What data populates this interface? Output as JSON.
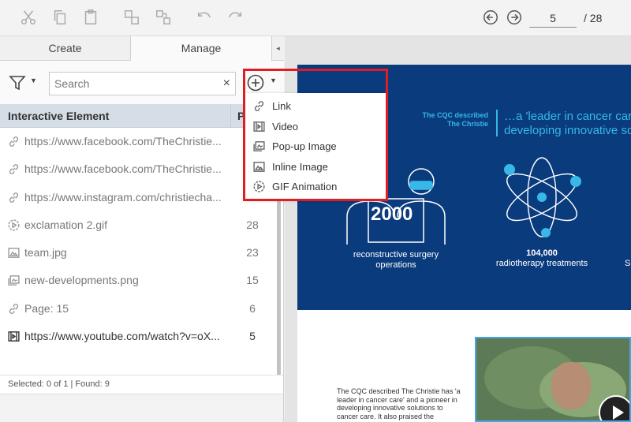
{
  "toolbar": {
    "current_page": "5",
    "total_pages": "/ 28"
  },
  "panel": {
    "tabs": [
      {
        "label": "Create"
      },
      {
        "label": "Manage"
      }
    ],
    "collapse_glyph": "◂",
    "search": {
      "placeholder": "Search",
      "value": "",
      "clear_glyph": "×"
    },
    "columns": {
      "name": "Interactive Element",
      "page": "Pa"
    },
    "rows": [
      {
        "icon": "link-icon",
        "text": "https://www.facebook.com/TheChristie...",
        "page": ""
      },
      {
        "icon": "link-icon",
        "text": "https://www.facebook.com/TheChristie...",
        "page": ""
      },
      {
        "icon": "link-icon",
        "text": "https://www.instagram.com/christiecha...",
        "page": ""
      },
      {
        "icon": "gif-icon",
        "text": "exclamation 2.gif",
        "page": "28"
      },
      {
        "icon": "image-icon",
        "text": "team.jpg",
        "page": "23"
      },
      {
        "icon": "popup-image-icon",
        "text": "new-developments.png",
        "page": "15"
      },
      {
        "icon": "link-icon",
        "text": "Page: 15",
        "page": "6"
      },
      {
        "icon": "video-icon",
        "text": "https://www.youtube.com/watch?v=oX...",
        "page": "5"
      }
    ],
    "status": "Selected: 0 of 1 | Found: 9"
  },
  "add_menu": {
    "items": [
      {
        "icon": "link-icon",
        "label": "Link"
      },
      {
        "icon": "video-icon",
        "label": "Video"
      },
      {
        "icon": "popup-image-icon",
        "label": "Pop-up Image"
      },
      {
        "icon": "image-icon",
        "label": "Inline Image"
      },
      {
        "icon": "gif-icon",
        "label": "GIF Animation"
      }
    ]
  },
  "document": {
    "cqc_small": "The CQC described The Christie",
    "cqc_quote_line1": "…a 'leader in cancer care",
    "cqc_quote_line2": "developing innovative solu",
    "stat1_value": "2000",
    "stat1_label": "reconstructive surgery operations",
    "stat2_value": "104,000",
    "stat2_label": "radiotherapy treatments",
    "stat3_edge": "S",
    "body_text": "The CQC described The Christie has 'a leader in cancer care' and a pioneer in developing innovative solutions to cancer care. It also praised the"
  },
  "colors": {
    "banner": "#0a3b7d",
    "accent_cyan": "#37b8e8",
    "highlight_red": "#e31b23",
    "list_header": "#d5dde6"
  }
}
